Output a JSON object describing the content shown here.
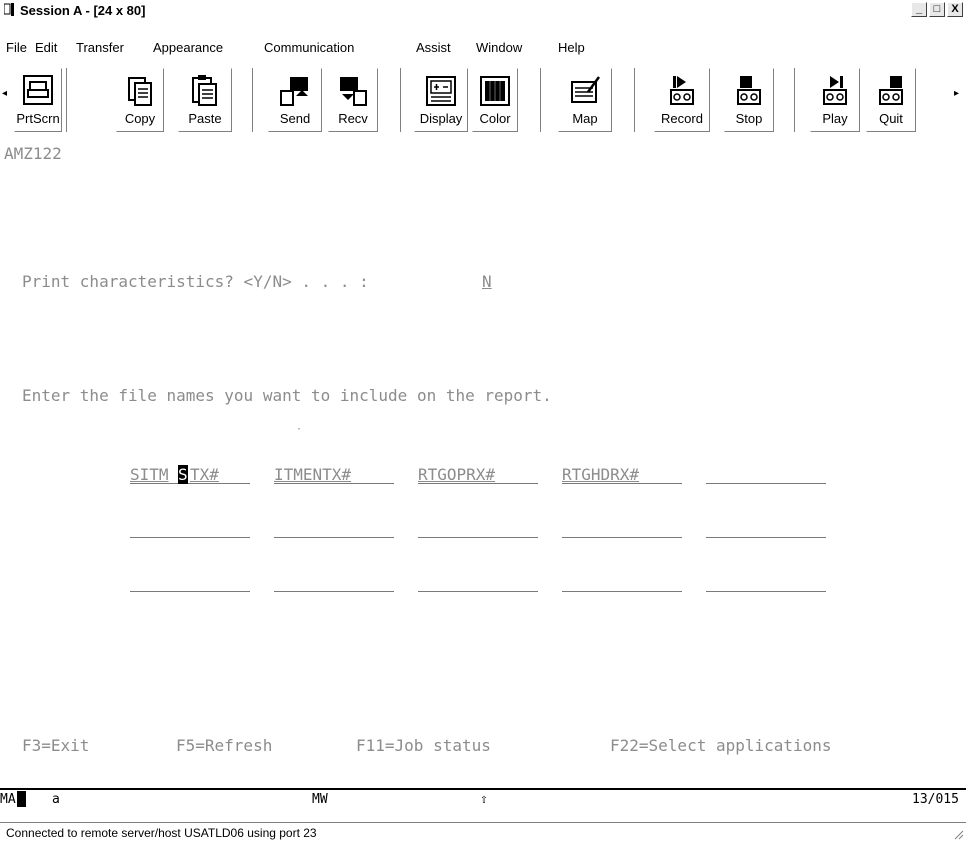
{
  "window": {
    "title": "Session A - [24 x 80]",
    "minimize": "_",
    "maximize": "□",
    "close": "X"
  },
  "menu": [
    "File",
    "Edit",
    "Transfer",
    "Appearance",
    "Communication",
    "Assist",
    "Window",
    "Help"
  ],
  "toolbar": {
    "scroll_left": "◂",
    "scroll_right": "▸",
    "buttons": [
      {
        "label": "PrtScrn",
        "icon": "printer-icon"
      },
      {
        "label": "Copy",
        "icon": "copy-icon"
      },
      {
        "label": "Paste",
        "icon": "paste-icon"
      },
      {
        "label": "Send",
        "icon": "send-icon"
      },
      {
        "label": "Recv",
        "icon": "receive-icon"
      },
      {
        "label": "Display",
        "icon": "display-icon"
      },
      {
        "label": "Color",
        "icon": "color-icon"
      },
      {
        "label": "Map",
        "icon": "map-icon"
      },
      {
        "label": "Record",
        "icon": "record-icon"
      },
      {
        "label": "Stop",
        "icon": "stop-icon"
      },
      {
        "label": "Play",
        "icon": "play-icon"
      },
      {
        "label": "Quit",
        "icon": "quit-icon"
      }
    ]
  },
  "screen": {
    "program_id": "AMZ122",
    "print_prompt": "Print characteristics? <Y/N> . . . :",
    "print_value": "N",
    "instructions": "Enter the file names you want to include on the report.",
    "file_fields": [
      [
        "SITMSTX#",
        "ITMENTX#",
        "RTGOPRX#",
        "RTGHDRX#",
        ""
      ],
      [
        "",
        "",
        "",
        "",
        ""
      ],
      [
        "",
        "",
        "",
        "",
        ""
      ]
    ],
    "function_keys": [
      "F3=Exit",
      "F5=Refresh",
      "F11=Job status",
      "F22=Select applications"
    ]
  },
  "oia": {
    "indicator": "MA",
    "session": "a",
    "user": "MW",
    "shift": "⇧",
    "position": "13/015"
  },
  "status": "Connected to remote server/host USATLD06 using port 23"
}
